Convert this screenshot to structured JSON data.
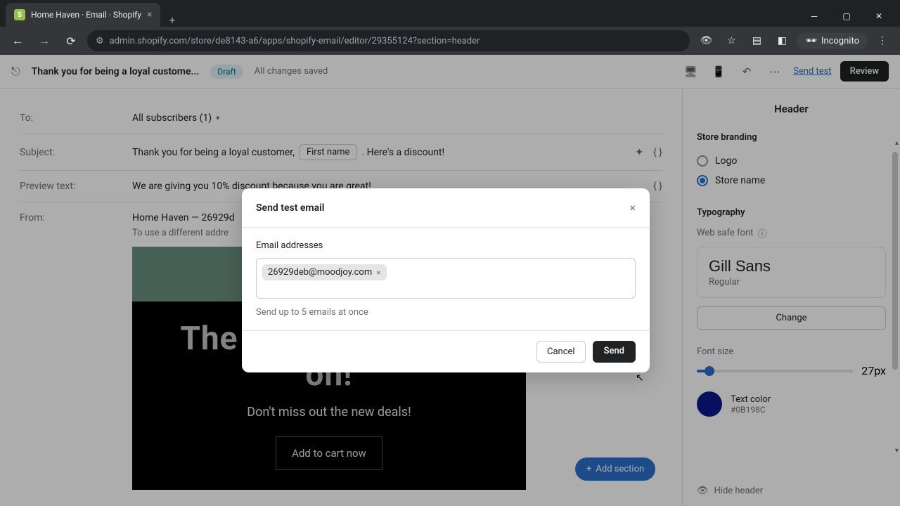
{
  "browser": {
    "tab_title": "Home Haven · Email · Shopify",
    "url": "admin.shopify.com/store/de8143-a6/apps/shopify-email/editor/29355124?section=header",
    "incognito_label": "Incognito"
  },
  "header": {
    "doc_title": "Thank you for being a loyal custome...",
    "draft_label": "Draft",
    "saved_label": "All changes saved",
    "send_test_label": "Send test",
    "review_label": "Review"
  },
  "fields": {
    "to_label": "To:",
    "to_value": "All subscribers (1)",
    "subject_label": "Subject:",
    "subject_prefix": "Thank you for being a loyal customer,",
    "subject_chip": "First name",
    "subject_suffix": ". Here's a discount!",
    "preview_label": "Preview text:",
    "preview_value": "We are giving you 10% discount because you are great!",
    "from_label": "From:",
    "from_value": "Home Haven — 26929d",
    "from_sub": "To use a different addre"
  },
  "email_preview": {
    "headline": "The summer sale is on!",
    "sub": "Don't miss out the new deals!",
    "cta": "Add to cart now"
  },
  "add_section_label": "Add section",
  "sidebar": {
    "title": "Header",
    "branding_label": "Store branding",
    "branding_options": [
      "Logo",
      "Store name"
    ],
    "branding_selected": 1,
    "typography_label": "Typography",
    "websafe_label": "Web safe font",
    "font_name": "Gill Sans",
    "font_variant": "Regular",
    "change_label": "Change",
    "fontsize_label": "Font size",
    "fontsize_value": "27px",
    "text_color_label": "Text color",
    "text_color_hex": "#0B198C",
    "hide_label": "Hide header"
  },
  "modal": {
    "title": "Send test email",
    "field_label": "Email addresses",
    "chip_value": "26929deb@moodjoy.com",
    "hint": "Send up to 5 emails at once",
    "cancel_label": "Cancel",
    "send_label": "Send"
  }
}
